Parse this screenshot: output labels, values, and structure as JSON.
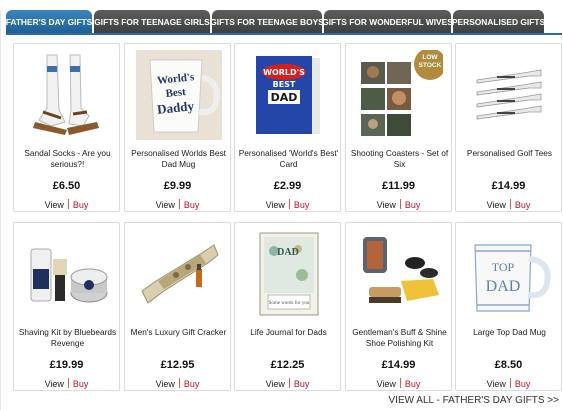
{
  "tabs": [
    {
      "label": "FATHER'S DAY GIFTS",
      "active": true
    },
    {
      "label": "GIFTS FOR TEENAGE GIRLS",
      "active": false
    },
    {
      "label": "GIFTS FOR TEENAGE BOYS",
      "active": false
    },
    {
      "label": "GIFTS FOR WONDERFUL WIVES",
      "active": false
    },
    {
      "label": "PERSONALISED GIFTS",
      "active": false
    }
  ],
  "products": [
    {
      "name": "Sandal Socks - Are you serious?!",
      "price": "£6.50",
      "view": "View",
      "buy": "Buy"
    },
    {
      "name": "Personalised Worlds Best Dad Mug",
      "price": "£9.99",
      "view": "View",
      "buy": "Buy",
      "image_text": "World's Best Daddy"
    },
    {
      "name": "Personalised 'World's Best' Card",
      "price": "£2.99",
      "view": "View",
      "buy": "Buy",
      "image_text": [
        "WORLD'S",
        "BEST",
        "DAD"
      ]
    },
    {
      "name": "Shooting Coasters - Set of Six",
      "price": "£11.99",
      "view": "View",
      "buy": "Buy",
      "badge": [
        "LOW",
        "STOCK"
      ]
    },
    {
      "name": "Personalised Golf Tees",
      "price": "£14.99",
      "view": "View",
      "buy": "Buy"
    },
    {
      "name": "Shaving Kit by Bluebeards Revenge",
      "price": "£19.99",
      "view": "View",
      "buy": "Buy"
    },
    {
      "name": "Men's Luxury Gift Cracker",
      "price": "£12.95",
      "view": "View",
      "buy": "Buy"
    },
    {
      "name": "Life Journal for Dads",
      "price": "£12.25",
      "view": "View",
      "buy": "Buy",
      "image_text": [
        "DAD",
        "Some words for you"
      ]
    },
    {
      "name": "Gentleman's Buff & Shine Shoe Polishing Kit",
      "price": "£14.99",
      "view": "View",
      "buy": "Buy"
    },
    {
      "name": "Large Top Dad Mug",
      "price": "£8.50",
      "view": "View",
      "buy": "Buy",
      "image_text": [
        "TOP",
        "DAD"
      ]
    }
  ],
  "footer": {
    "view_all": "VIEW ALL - FATHER'S DAY GIFTS >>"
  }
}
